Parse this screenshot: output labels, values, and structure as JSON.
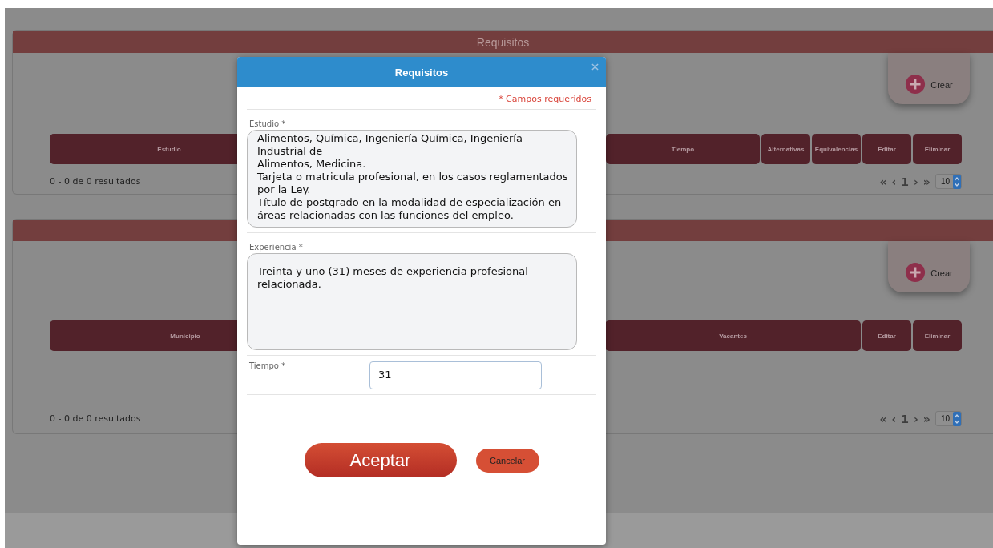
{
  "panels": [
    {
      "title": "Requisitos",
      "create_button": "Crear",
      "columns": [
        {
          "label": "Estudio"
        },
        {
          "label": "Tiempo"
        },
        {
          "label": "Alternativas"
        },
        {
          "label": "Equivalencias"
        },
        {
          "label": "Editar"
        },
        {
          "label": "Eliminar"
        }
      ],
      "results": "0 - 0 de 0 resultados",
      "pagination": {
        "first": "«",
        "prev": "‹",
        "page": "1",
        "next": "›",
        "last": "»",
        "page_size": "10"
      }
    },
    {
      "create_button": "Crear",
      "columns": [
        {
          "label": "Municipio"
        },
        {
          "label": "Vacantes"
        },
        {
          "label": "Editar"
        },
        {
          "label": "Eliminar"
        }
      ],
      "results": "0 - 0 de 0 resultados",
      "pagination": {
        "first": "«",
        "prev": "‹",
        "page": "1",
        "next": "›",
        "last": "»",
        "page_size": "10"
      }
    }
  ],
  "modal": {
    "title": "Requisitos",
    "required_note": "* Campos requeridos",
    "fields": [
      {
        "kind": "textarea",
        "label": "Estudio *",
        "value": "Alimentos, Química, Ingeniería Química, Ingeniería\nIndustrial de\nAlimentos, Medicina.\nTarjeta o matricula profesional, en los casos reglamentados\npor la Ley.\nTítulo de postgrado en la modalidad de especialización en\náreas relacionadas con las funciones del empleo."
      },
      {
        "kind": "textarea",
        "label": "Experiencia *",
        "value": "Treinta y uno (31) meses de experiencia profesional\nrelacionada."
      },
      {
        "kind": "input",
        "label": "Tiempo *",
        "value": "31"
      }
    ],
    "buttons": [
      {
        "kind": "primary",
        "label": "Aceptar"
      },
      {
        "kind": "secondary",
        "label": "Cancelar"
      }
    ]
  }
}
